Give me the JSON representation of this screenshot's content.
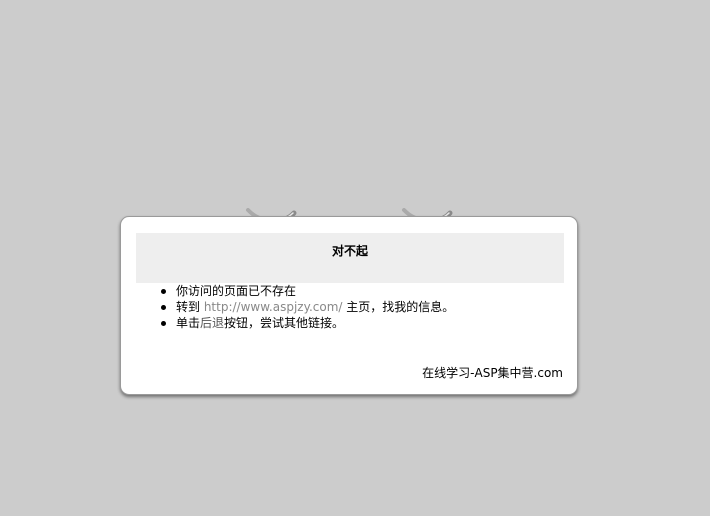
{
  "dialog": {
    "title": "对不起",
    "items": [
      {
        "text": "你访问的页面已不存在"
      },
      {
        "prefix": "转到 ",
        "link": "http://www.aspjzy.com/",
        "suffix": " 主页，找我的信息。"
      },
      {
        "prefix": "单击",
        "link": "后退",
        "suffix": "按钮，尝试其他链接。"
      }
    ],
    "footer": "在线学习-ASP集中营.com"
  },
  "colors": {
    "background": "#cccccc",
    "card": "#ffffff",
    "title_bar": "#eeeeee",
    "link": "#888888"
  }
}
